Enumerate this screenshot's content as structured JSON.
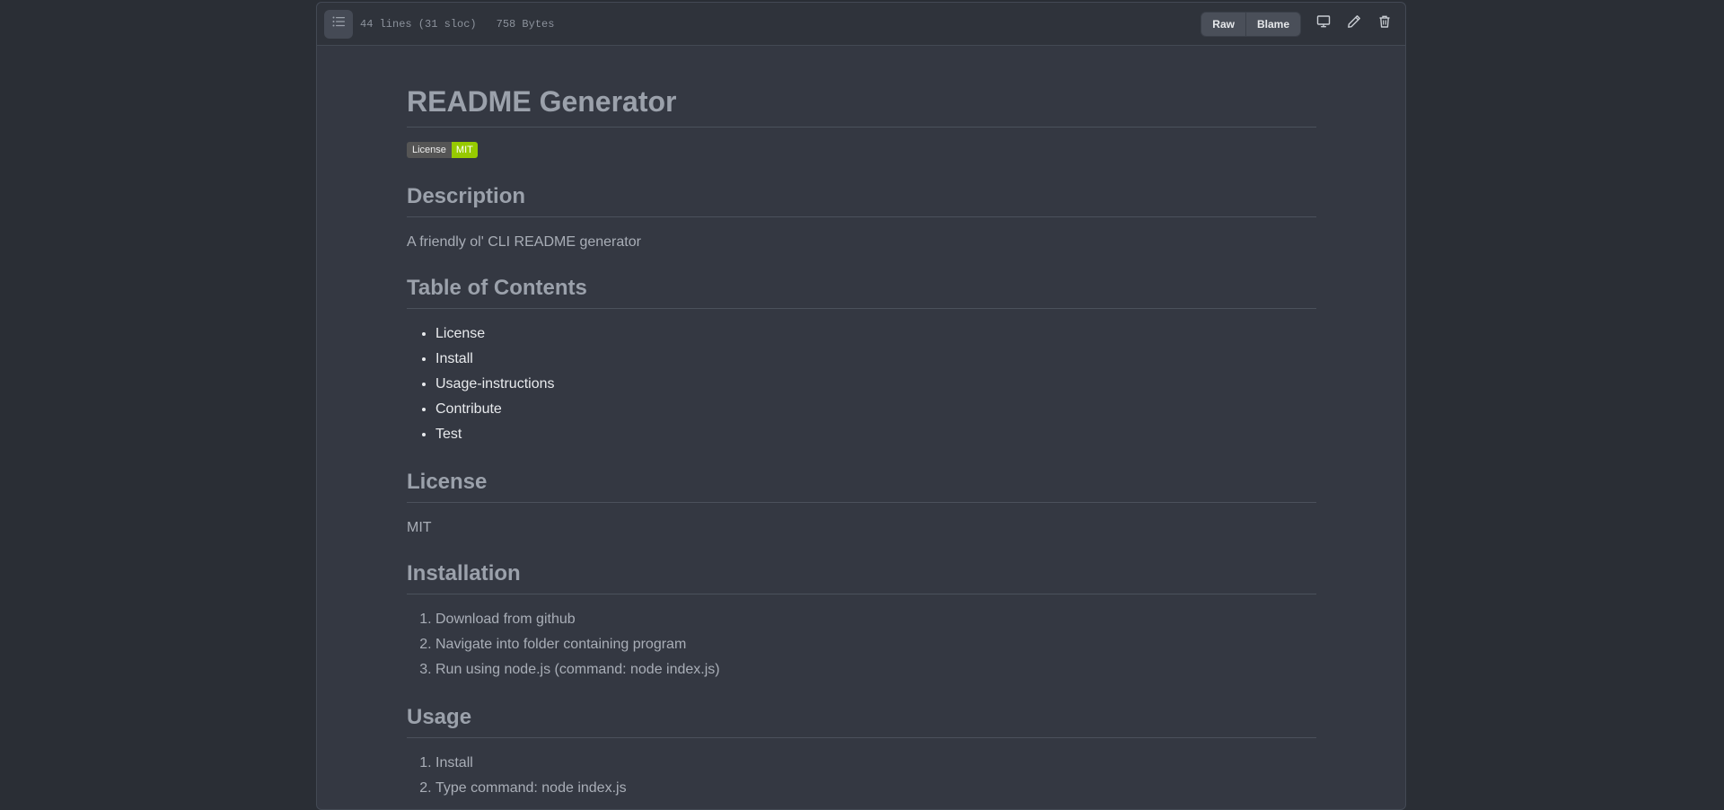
{
  "header": {
    "lines": "44 lines (31 sloc)",
    "size": "758 Bytes",
    "raw_label": "Raw",
    "blame_label": "Blame",
    "icons": [
      "list-icon",
      "desktop-icon",
      "pencil-icon",
      "trash-icon"
    ]
  },
  "readme": {
    "title": "README Generator",
    "badge": {
      "left": "License",
      "right": "MIT"
    },
    "description_heading": "Description",
    "description_text": "A friendly ol' CLI README generator",
    "toc_heading": "Table of Contents",
    "toc_items": [
      "License",
      "Install",
      "Usage-instructions",
      "Contribute",
      "Test"
    ],
    "license_heading": "License",
    "license_text": "MIT",
    "install_heading": "Installation",
    "install_steps": [
      "Download from github",
      "Navigate into folder containing program",
      "Run using node.js (command: node index.js)"
    ],
    "usage_heading": "Usage",
    "usage_steps": [
      "Install",
      "Type command: node index.js"
    ]
  },
  "colors": {
    "page_bg": "#2a2e35",
    "panel_bg": "#343842",
    "badge_green": "#97ca00"
  }
}
